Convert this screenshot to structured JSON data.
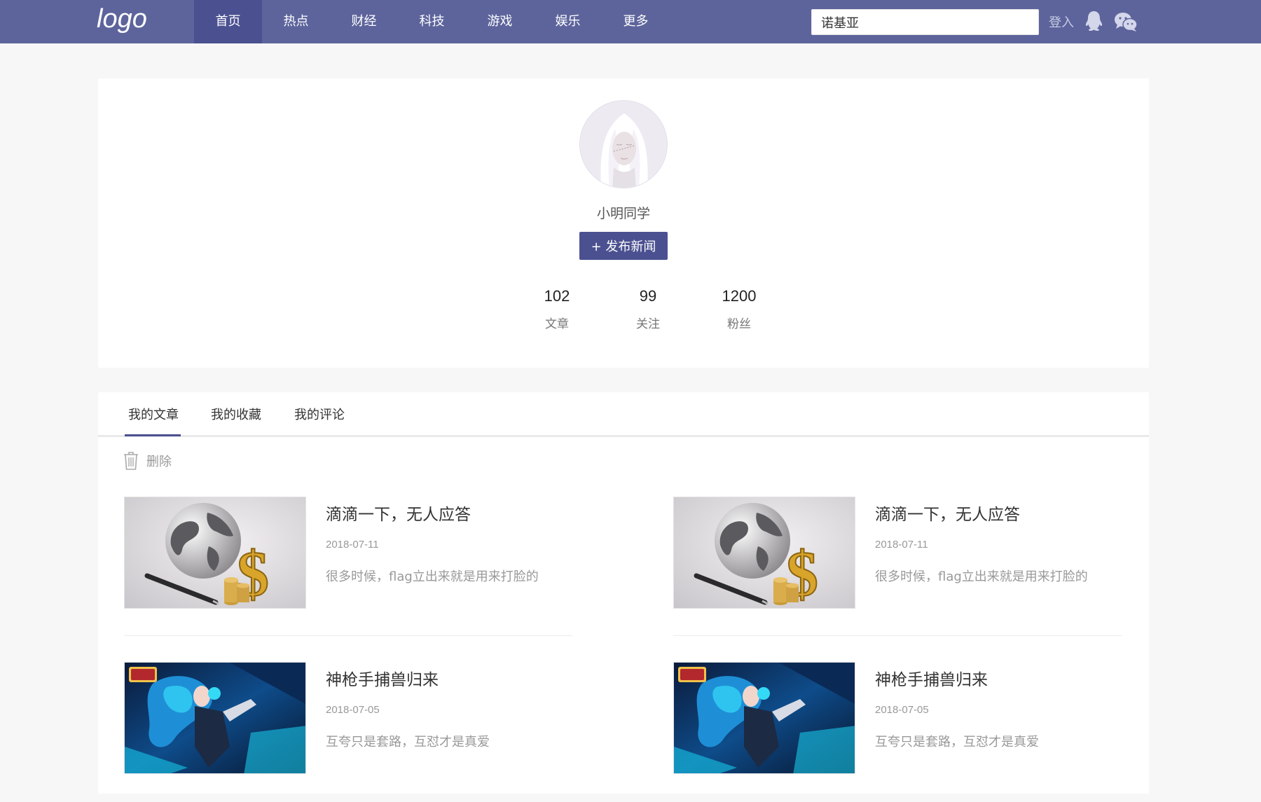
{
  "header": {
    "logo": "logo",
    "nav": [
      "首页",
      "热点",
      "财经",
      "科技",
      "游戏",
      "娱乐",
      "更多"
    ],
    "active_nav": "首页",
    "search_value": "诺基亚",
    "login": "登入",
    "icons": [
      "qq-icon",
      "wechat-icon"
    ],
    "bar_color": "#5d649c",
    "active_color": "#4b5190"
  },
  "profile": {
    "username": "小明同学",
    "publish_button": "+ 发布新闻",
    "stats": [
      {
        "value": "102",
        "label": "文章"
      },
      {
        "value": "99",
        "label": "关注"
      },
      {
        "value": "1200",
        "label": "粉丝"
      }
    ]
  },
  "tabs": {
    "items": [
      "我的文章",
      "我的收藏",
      "我的评论"
    ],
    "active": "我的文章",
    "delete_label": "删除"
  },
  "articles": [
    {
      "title": "滴滴一下，无人应答",
      "date": "2018-07-11",
      "desc": "很多时候，flag立出来就是用来打脸的",
      "thumb": "globe-dollar-image"
    },
    {
      "title": "滴滴一下，无人应答",
      "date": "2018-07-11",
      "desc": "很多时候，flag立出来就是用来打脸的",
      "thumb": "globe-dollar-image"
    },
    {
      "title": "神枪手捕兽归来",
      "date": "2018-07-05",
      "desc": "互夸只是套路，互怼才是真爱",
      "thumb": "game-hero-image"
    },
    {
      "title": "神枪手捕兽归来",
      "date": "2018-07-05",
      "desc": "互夸只是套路，互怼才是真爱",
      "thumb": "game-hero-image"
    }
  ]
}
